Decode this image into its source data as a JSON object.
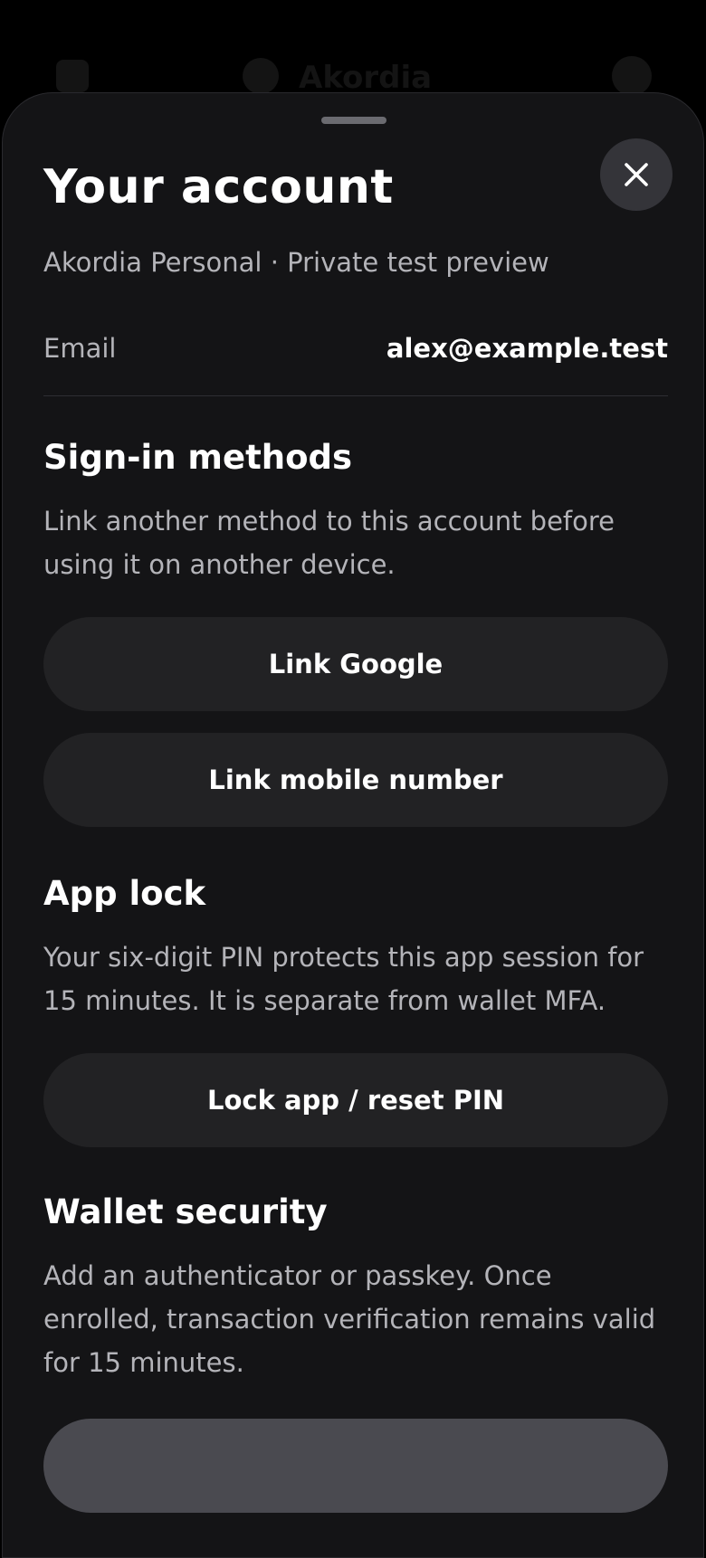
{
  "background": {
    "title": "Akordia"
  },
  "sheet": {
    "title": "Your account",
    "subtitle": "Akordia Personal · Private test preview",
    "close_icon": "close-icon",
    "email": {
      "label": "Email",
      "value": "alex@example.test"
    },
    "signin": {
      "heading": "Sign-in methods",
      "description": "Link another method to this account before using it on another device.",
      "link_google_label": "Link Google",
      "link_mobile_label": "Link mobile number"
    },
    "app_lock": {
      "heading": "App lock",
      "description": "Your six-digit PIN protects this app session for 15 minutes. It is separate from wallet MFA.",
      "lock_button_label": "Lock app / reset PIN"
    },
    "wallet_security": {
      "heading": "Wallet security",
      "description": "Add an authenticator or passkey. Once enrolled, transaction verification remains valid for 15 minutes."
    }
  },
  "colors": {
    "sheet_bg": "#141416",
    "button_bg": "#222224",
    "muted_text": "#b4b4b9",
    "close_bg": "#343439"
  }
}
